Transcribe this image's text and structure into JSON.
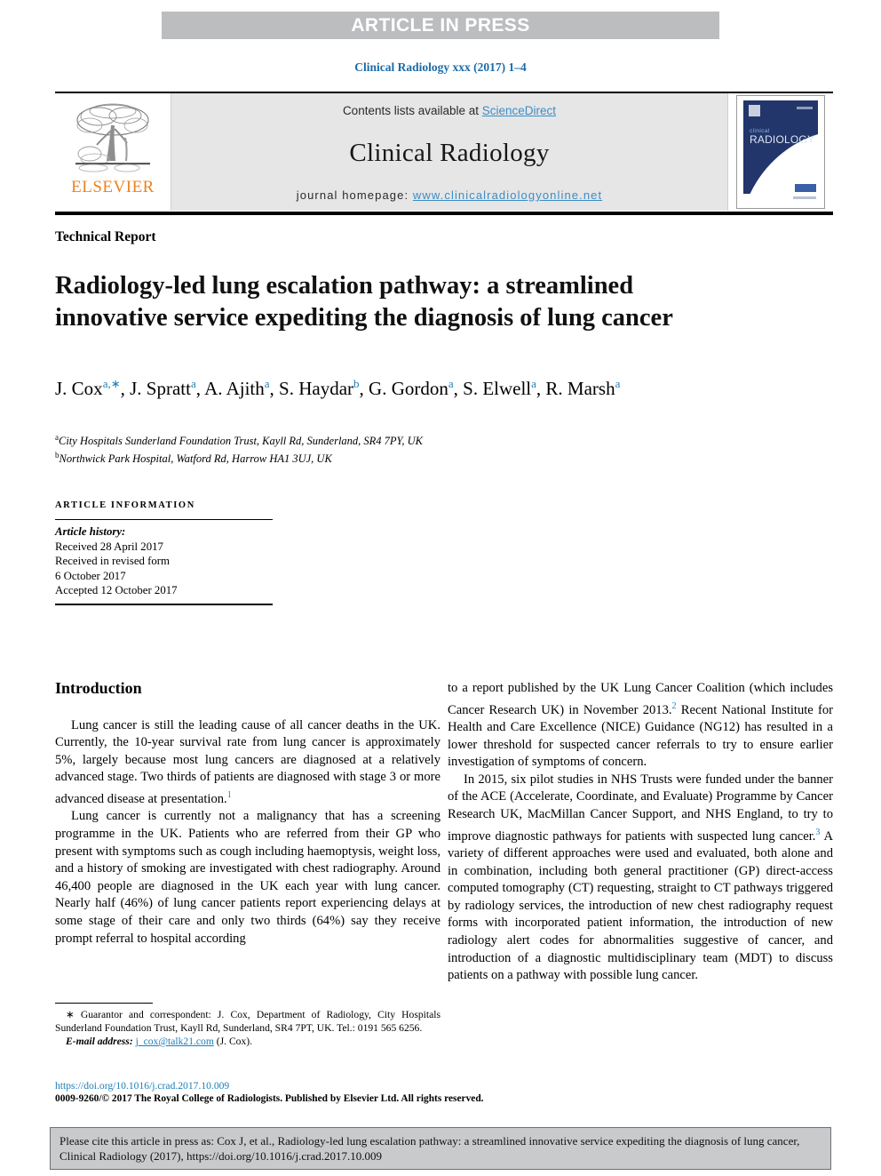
{
  "press_band": {
    "label": "ARTICLE IN PRESS"
  },
  "running_head": {
    "text": "Clinical Radiology xxx (2017) 1–4"
  },
  "masthead": {
    "publisher_word": "ELSEVIER",
    "contents_prefix": "Contents lists available at ",
    "contents_link": "ScienceDirect",
    "journal_name": "Clinical Radiology",
    "homepage_prefix": "journal homepage: ",
    "homepage_url": "www.clinicalradiologyonline.net",
    "cover": {
      "line1": "clinical",
      "line2": "RADIOLOGY"
    }
  },
  "article": {
    "kicker": "Technical Report",
    "title": "Radiology-led lung escalation pathway: a streamlined innovative service expediting the diagnosis of lung cancer",
    "authors": [
      {
        "name": "J. Cox",
        "marks": "a,∗"
      },
      {
        "name": "J. Spratt",
        "marks": "a"
      },
      {
        "name": "A. Ajith",
        "marks": "a"
      },
      {
        "name": "S. Haydar",
        "marks": "b"
      },
      {
        "name": "G. Gordon",
        "marks": "a"
      },
      {
        "name": "S. Elwell",
        "marks": "a"
      },
      {
        "name": "R. Marsh",
        "marks": "a"
      }
    ],
    "affiliations": [
      {
        "mark": "a",
        "text": "City Hospitals Sunderland Foundation Trust, Kayll Rd, Sunderland, SR4 7PY, UK"
      },
      {
        "mark": "b",
        "text": "Northwick Park Hospital, Watford Rd, Harrow HA1 3UJ, UK"
      }
    ]
  },
  "article_information": {
    "heading": "ARTICLE INFORMATION",
    "history_label": "Article history:",
    "history_lines": [
      "Received 28 April 2017",
      "Received in revised form",
      "6 October 2017",
      "Accepted 12 October 2017"
    ]
  },
  "introduction": {
    "heading": "Introduction",
    "p1_a": "Lung cancer is still the leading cause of all cancer deaths in the UK. Currently, the 10-year survival rate from lung cancer is approximately 5%, largely because most lung cancers are diagnosed at a relatively advanced stage. Two thirds of patients are diagnosed with stage 3 or more advanced disease at presentation.",
    "p1_ref": "1",
    "p2": "Lung cancer is currently not a malignancy that has a screening programme in the UK. Patients who are referred from their GP who present with symptoms such as cough including haemoptysis, weight loss, and a history of smoking are investigated with chest radiography. Around 46,400 people are diagnosed in the UK each year with lung cancer. Nearly half (46%) of lung cancer patients report experiencing delays at some stage of their care and only two thirds (64%) say they receive prompt referral to hospital according",
    "p2_cont_a": "to a report published by the UK Lung Cancer Coalition (which includes Cancer Research UK) in November 2013.",
    "p2_cont_ref": "2",
    "p2_cont_b": "Recent National Institute for Health and Care Excellence (NICE) Guidance (NG12) has resulted in a lower threshold for suspected cancer referrals to try to ensure earlier investigation of symptoms of concern.",
    "p3_a": "In 2015, six pilot studies in NHS Trusts were funded under the banner of the ACE (Accelerate, Coordinate, and Evaluate) Programme by Cancer Research UK, MacMillan Cancer Support, and NHS England, to try to improve diagnostic pathways for patients with suspected lung cancer.",
    "p3_ref": "3",
    "p3_b": "A variety of different approaches were used and evaluated, both alone and in combination, including both general practitioner (GP) direct-access computed tomography (CT) requesting, straight to CT pathways triggered by radiology services, the introduction of new chest radiography request forms with incorporated patient information, the introduction of new radiology alert codes for abnormalities suggestive of cancer, and introduction of a diagnostic multidisciplinary team (MDT) to discuss patients on a pathway with possible lung cancer."
  },
  "footnote": {
    "star": "∗",
    "correspondence": "Guarantor and correspondent: J. Cox, Department of Radiology, City Hospitals Sunderland Foundation Trust, Kayll Rd, Sunderland, SR4 7PT, UK. Tel.: 0191 565 6256.",
    "email_label": "E-mail address:",
    "email": "j_cox@talk21.com",
    "email_suffix": "(J. Cox)."
  },
  "doi_block": {
    "doi": "https://doi.org/10.1016/j.crad.2017.10.009",
    "copyright": "0009-9260/© 2017 The Royal College of Radiologists. Published by Elsevier Ltd. All rights reserved."
  },
  "citation_footer": {
    "text": "Please cite this article in press as: Cox J, et al., Radiology-led lung escalation pathway: a streamlined innovative service expediting the diagnosis of lung cancer, Clinical Radiology (2017), https://doi.org/10.1016/j.crad.2017.10.009"
  },
  "colors": {
    "press_band_bg": "#bcbdbf",
    "link_blue": "#1b7fb8",
    "sd_link_blue": "#3c8dc5",
    "elsevier_orange": "#ec8320",
    "masthead_grey": "#e6e6e6",
    "cover_navy": "#22366b",
    "cite_box_bg": "#c9cacc"
  }
}
